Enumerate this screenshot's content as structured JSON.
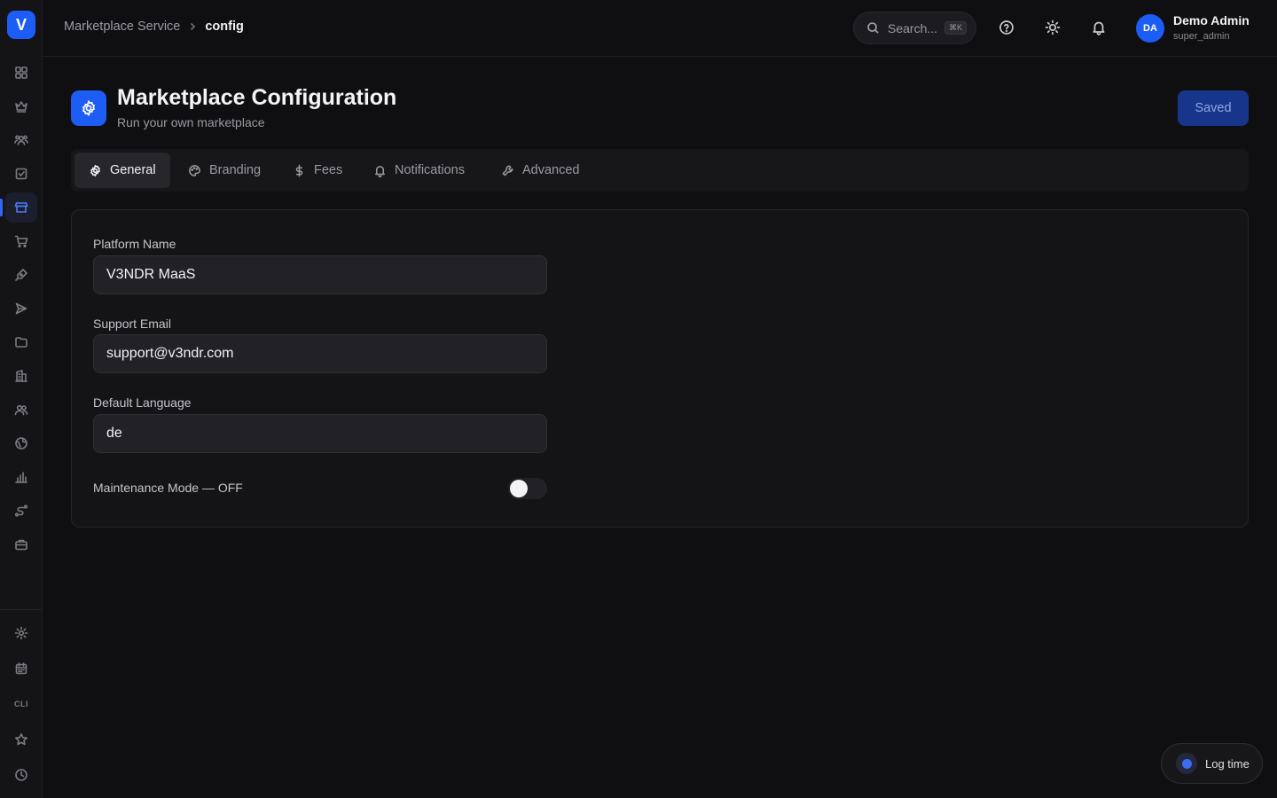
{
  "app": {
    "logo_letter": "V"
  },
  "breadcrumb": {
    "parent": "Marketplace Service",
    "current": "config"
  },
  "search": {
    "placeholder": "Search...",
    "shortcut": "⌘K"
  },
  "user": {
    "initials": "DA",
    "name": "Demo Admin",
    "role": "super_admin"
  },
  "header": {
    "title": "Marketplace Configuration",
    "subtitle": "Run your own marketplace",
    "save_label": "Saved"
  },
  "tabs": [
    {
      "label": "General",
      "icon": "gear-icon",
      "active": true
    },
    {
      "label": "Branding",
      "icon": "palette-icon",
      "active": false
    },
    {
      "label": "Fees",
      "icon": "dollar-icon",
      "active": false
    },
    {
      "label": "Notifications",
      "icon": "bell-icon",
      "active": false
    },
    {
      "label": "Advanced",
      "icon": "wrench-icon",
      "active": false
    }
  ],
  "form": {
    "platform_name": {
      "label": "Platform Name",
      "value": "V3NDR MaaS"
    },
    "support_email": {
      "label": "Support Email",
      "value": "support@v3ndr.com"
    },
    "default_language": {
      "label": "Default Language",
      "value": "de"
    },
    "maintenance_mode": {
      "label": "Maintenance Mode — OFF",
      "enabled": false
    }
  },
  "sidebar": {
    "items": [
      {
        "icon": "dashboard-icon"
      },
      {
        "icon": "crown-icon"
      },
      {
        "icon": "users-icon"
      },
      {
        "icon": "checkbox-icon"
      },
      {
        "icon": "store-icon",
        "active": true
      },
      {
        "icon": "cart-icon"
      },
      {
        "icon": "pen-tool-icon"
      },
      {
        "icon": "send-icon"
      },
      {
        "icon": "folder-icon"
      },
      {
        "icon": "building-icon"
      },
      {
        "icon": "team-icon"
      },
      {
        "icon": "globe-icon"
      },
      {
        "icon": "bar-chart-icon"
      },
      {
        "icon": "route-icon"
      },
      {
        "icon": "briefcase-icon"
      }
    ],
    "bottom_items": [
      {
        "icon": "settings-icon"
      },
      {
        "icon": "calendar-icon"
      },
      {
        "icon": "cli-icon",
        "label": "CLI"
      },
      {
        "icon": "star-icon"
      },
      {
        "icon": "clock-icon"
      }
    ]
  },
  "log_time": {
    "label": "Log time"
  },
  "colors": {
    "accent": "#1d5cf5",
    "background": "#0f0f12",
    "card": "#141417"
  }
}
